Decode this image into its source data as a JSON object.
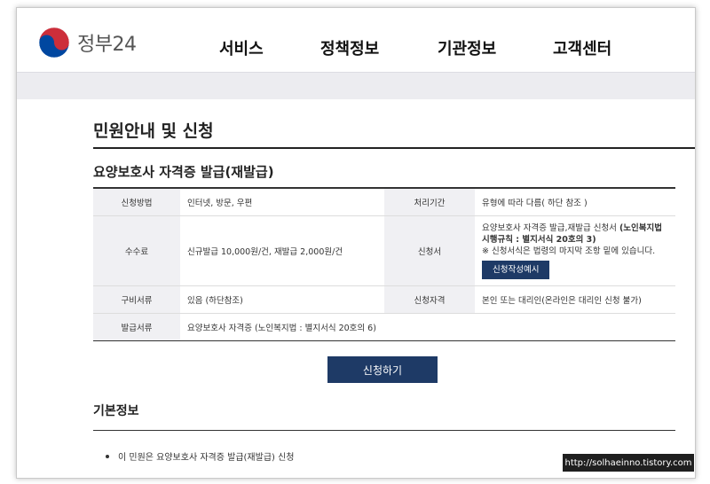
{
  "header": {
    "logo_text": "정부24",
    "nav": [
      "서비스",
      "정책정보",
      "기관정보",
      "고객센터"
    ]
  },
  "page_title": "민원안내 및 신청",
  "section_title": "요양보호사 자격증 발급(재발급)",
  "table": {
    "method_label": "신청방법",
    "method_value": "인터넷, 방문, 우편",
    "period_label": "처리기간",
    "period_value": "유형에 따라 다름( 하단 참조 )",
    "fee_label": "수수료",
    "fee_value": "신규발급 10,000원/건, 재발급 2,000원/건",
    "form_label": "신청서",
    "form_value_1": "요양보호사 자격증 발급,재발급 신청서",
    "form_value_bold": "(노인복지법 시행규칙 : 별지서식 20호의 3)",
    "form_note": "※ 신청서식은 법령의 마지막 조항 밑에 있습니다.",
    "form_button": "신청작성예시",
    "docs_label": "구비서류",
    "docs_value": "있음 (하단참조)",
    "qual_label": "신청자격",
    "qual_value": "본인 또는 대리인(온라인은 대리인 신청 불가)",
    "issue_label": "발급서류",
    "issue_value": "요양보호사 자격증 (노인복지법 : 별지서식 20호의 6)"
  },
  "apply_button": "신청하기",
  "basic_info": {
    "title": "기본정보",
    "item_1": "이 민원은 요양보호사 자격증 발급(재발급) 신청"
  },
  "watermark": "http://solhaeinno.tistory.com",
  "colors": {
    "accent": "#1e3a66",
    "band": "#ececf0",
    "logo_red": "#cd2e3a",
    "logo_blue": "#0047a0"
  }
}
